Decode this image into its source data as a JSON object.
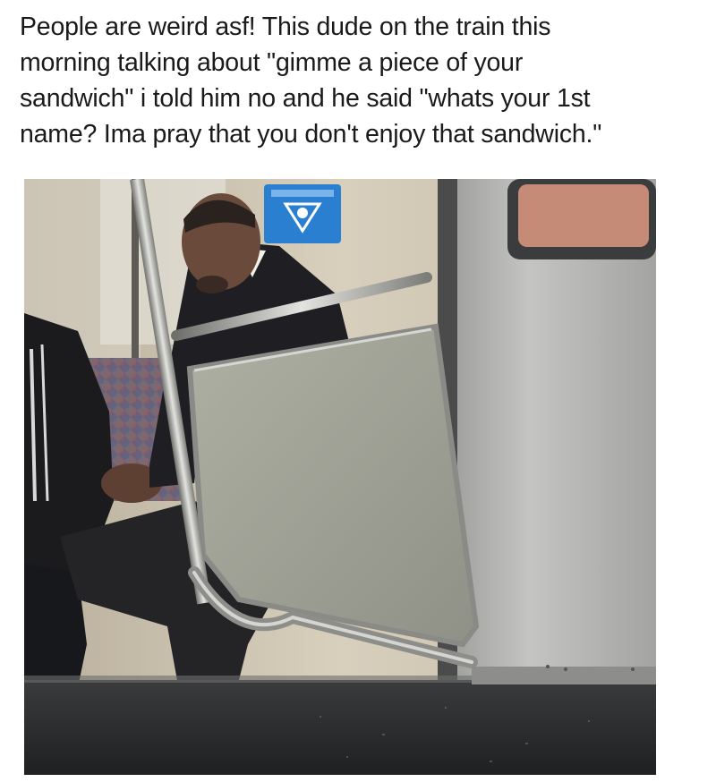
{
  "post": {
    "caption_lines": [
      "People are weird asf! This dude on the train this",
      "morning talking about \"gimme a piece of your",
      "sandwich\" i told him no and he said \"whats your 1st",
      "name? Ima pray that you don't enjoy that sandwich.\""
    ]
  },
  "photo": {
    "scene": "man in suit seated on subway train beside stanchion pole and partition",
    "colors": {
      "wall": "#c9bfae",
      "steel": "#a9aaa6",
      "floor": "#2b2c2e",
      "seat_fabric": "#6a5f78",
      "suit": "#1f1e22",
      "sign_blue": "#2a7fd0"
    }
  }
}
